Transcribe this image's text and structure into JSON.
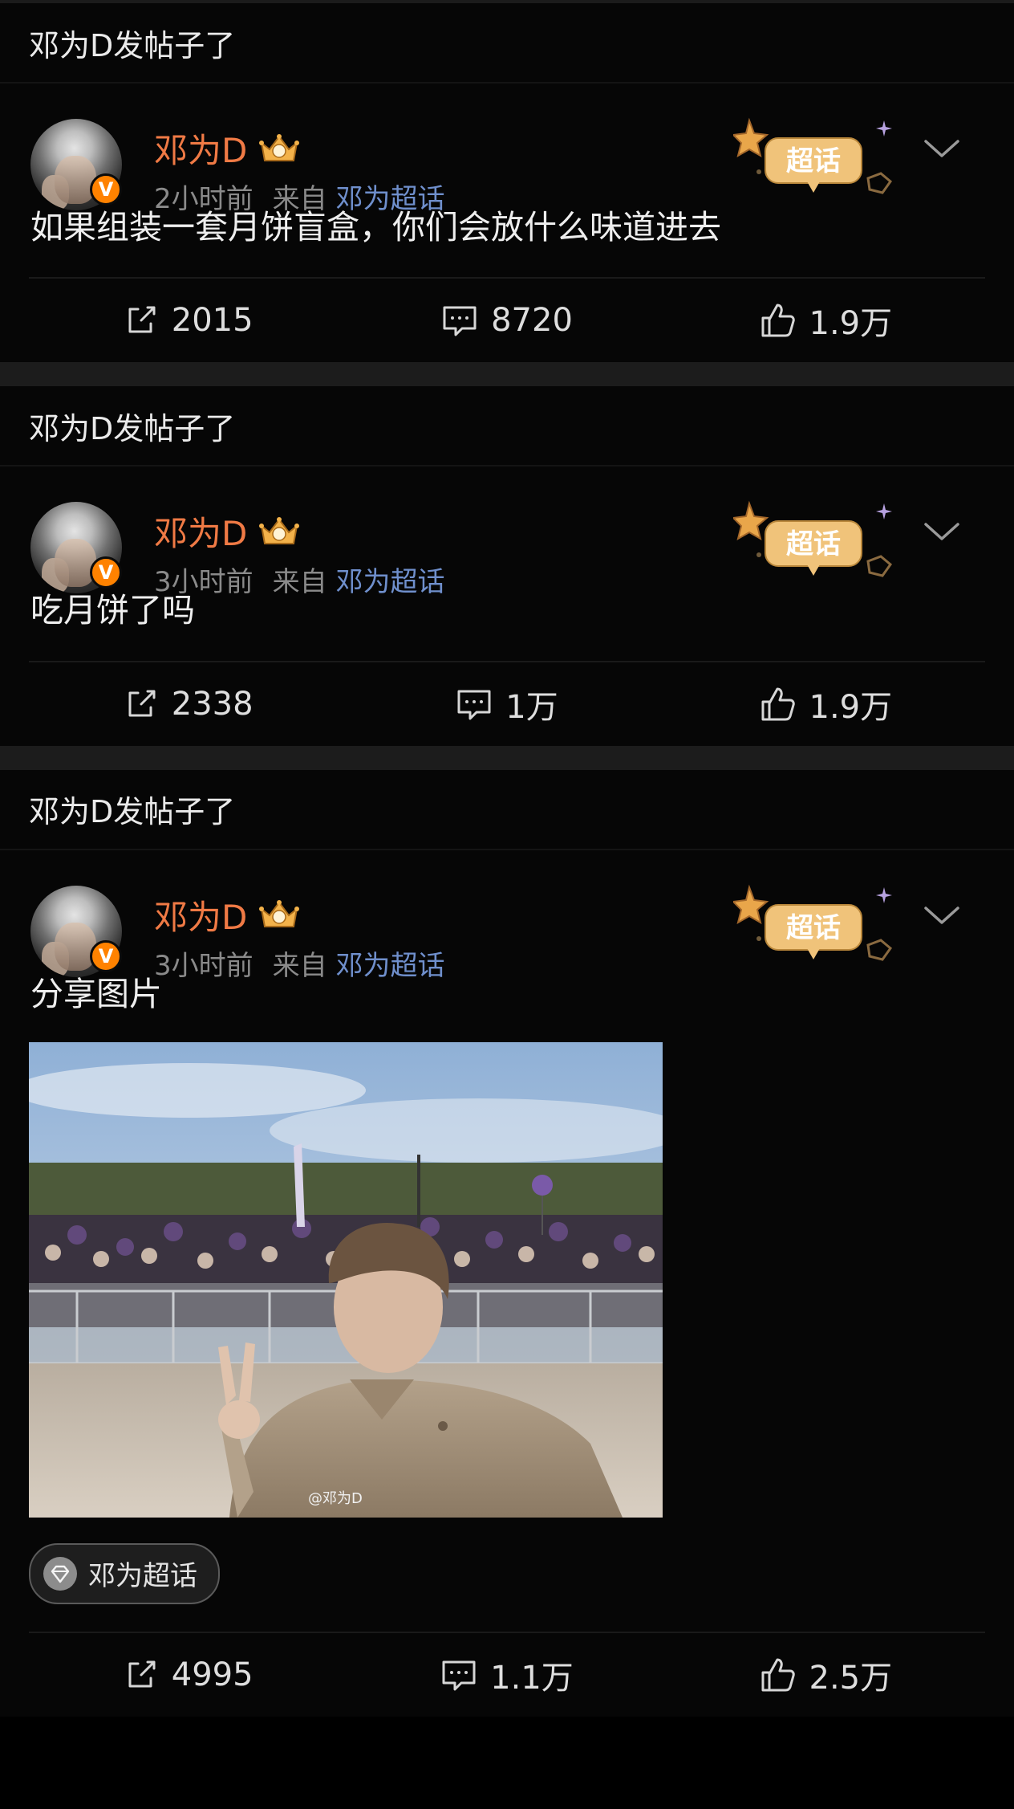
{
  "posts": [
    {
      "header": "邓为D发帖子了",
      "author": "邓为D",
      "time": "2小时前",
      "source_prefix": "来自",
      "source": "邓为超话",
      "verified_mark": "V",
      "badge_label": "超话",
      "text": "如果组装一套月饼盲盒，你们会放什么味道进去",
      "reposts": "2015",
      "comments": "8720",
      "likes": "1.9万"
    },
    {
      "header": "邓为D发帖子了",
      "author": "邓为D",
      "time": "3小时前",
      "source_prefix": "来自",
      "source": "邓为超话",
      "verified_mark": "V",
      "badge_label": "超话",
      "text": "吃月饼了吗",
      "reposts": "2338",
      "comments": "1万",
      "likes": "1.9万"
    },
    {
      "header": "邓为D发帖子了",
      "author": "邓为D",
      "time": "3小时前",
      "source_prefix": "来自",
      "source": "邓为超话",
      "verified_mark": "V",
      "badge_label": "超话",
      "text": "分享图片",
      "image_watermark": "@邓为D",
      "topic_chip": "邓为超话",
      "reposts": "4995",
      "comments": "1.1万",
      "likes": "2.5万"
    }
  ],
  "icons": {
    "repost": "repost-icon",
    "comment": "comment-icon",
    "like": "thumbs-up-icon",
    "expand": "chevron-down-icon",
    "crown": "crown-level-icon",
    "topic": "diamond-icon"
  },
  "colors": {
    "author_name": "#f07a45",
    "source_link": "#6f8fcc",
    "verified_badge": "#ff8200",
    "background": "#000000"
  }
}
